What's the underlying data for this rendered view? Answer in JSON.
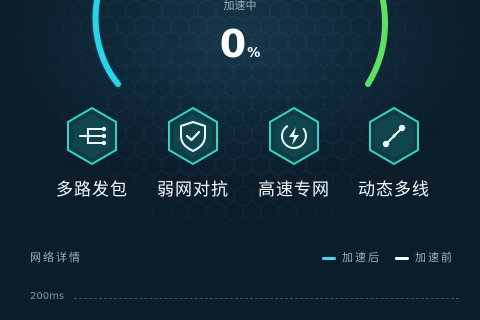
{
  "gauge": {
    "status_text": "加速中",
    "value": 0,
    "unit": "%"
  },
  "features": [
    {
      "label": "多路发包",
      "icon": "multipath-icon"
    },
    {
      "label": "弱网对抗",
      "icon": "shield-check-icon"
    },
    {
      "label": "高速专网",
      "icon": "lightning-icon"
    },
    {
      "label": "动态多线",
      "icon": "dynamic-link-icon"
    }
  ],
  "details": {
    "title": "网络详情",
    "legend": [
      {
        "label": "加速后",
        "color": "#4fd0f0"
      },
      {
        "label": "加速前",
        "color": "#ffffff"
      }
    ],
    "y_ticks": [
      "200ms"
    ]
  },
  "colors": {
    "arc_left": "#29d3ea",
    "arc_right": "#5ee064",
    "icon_glow": "#26d1c0"
  }
}
